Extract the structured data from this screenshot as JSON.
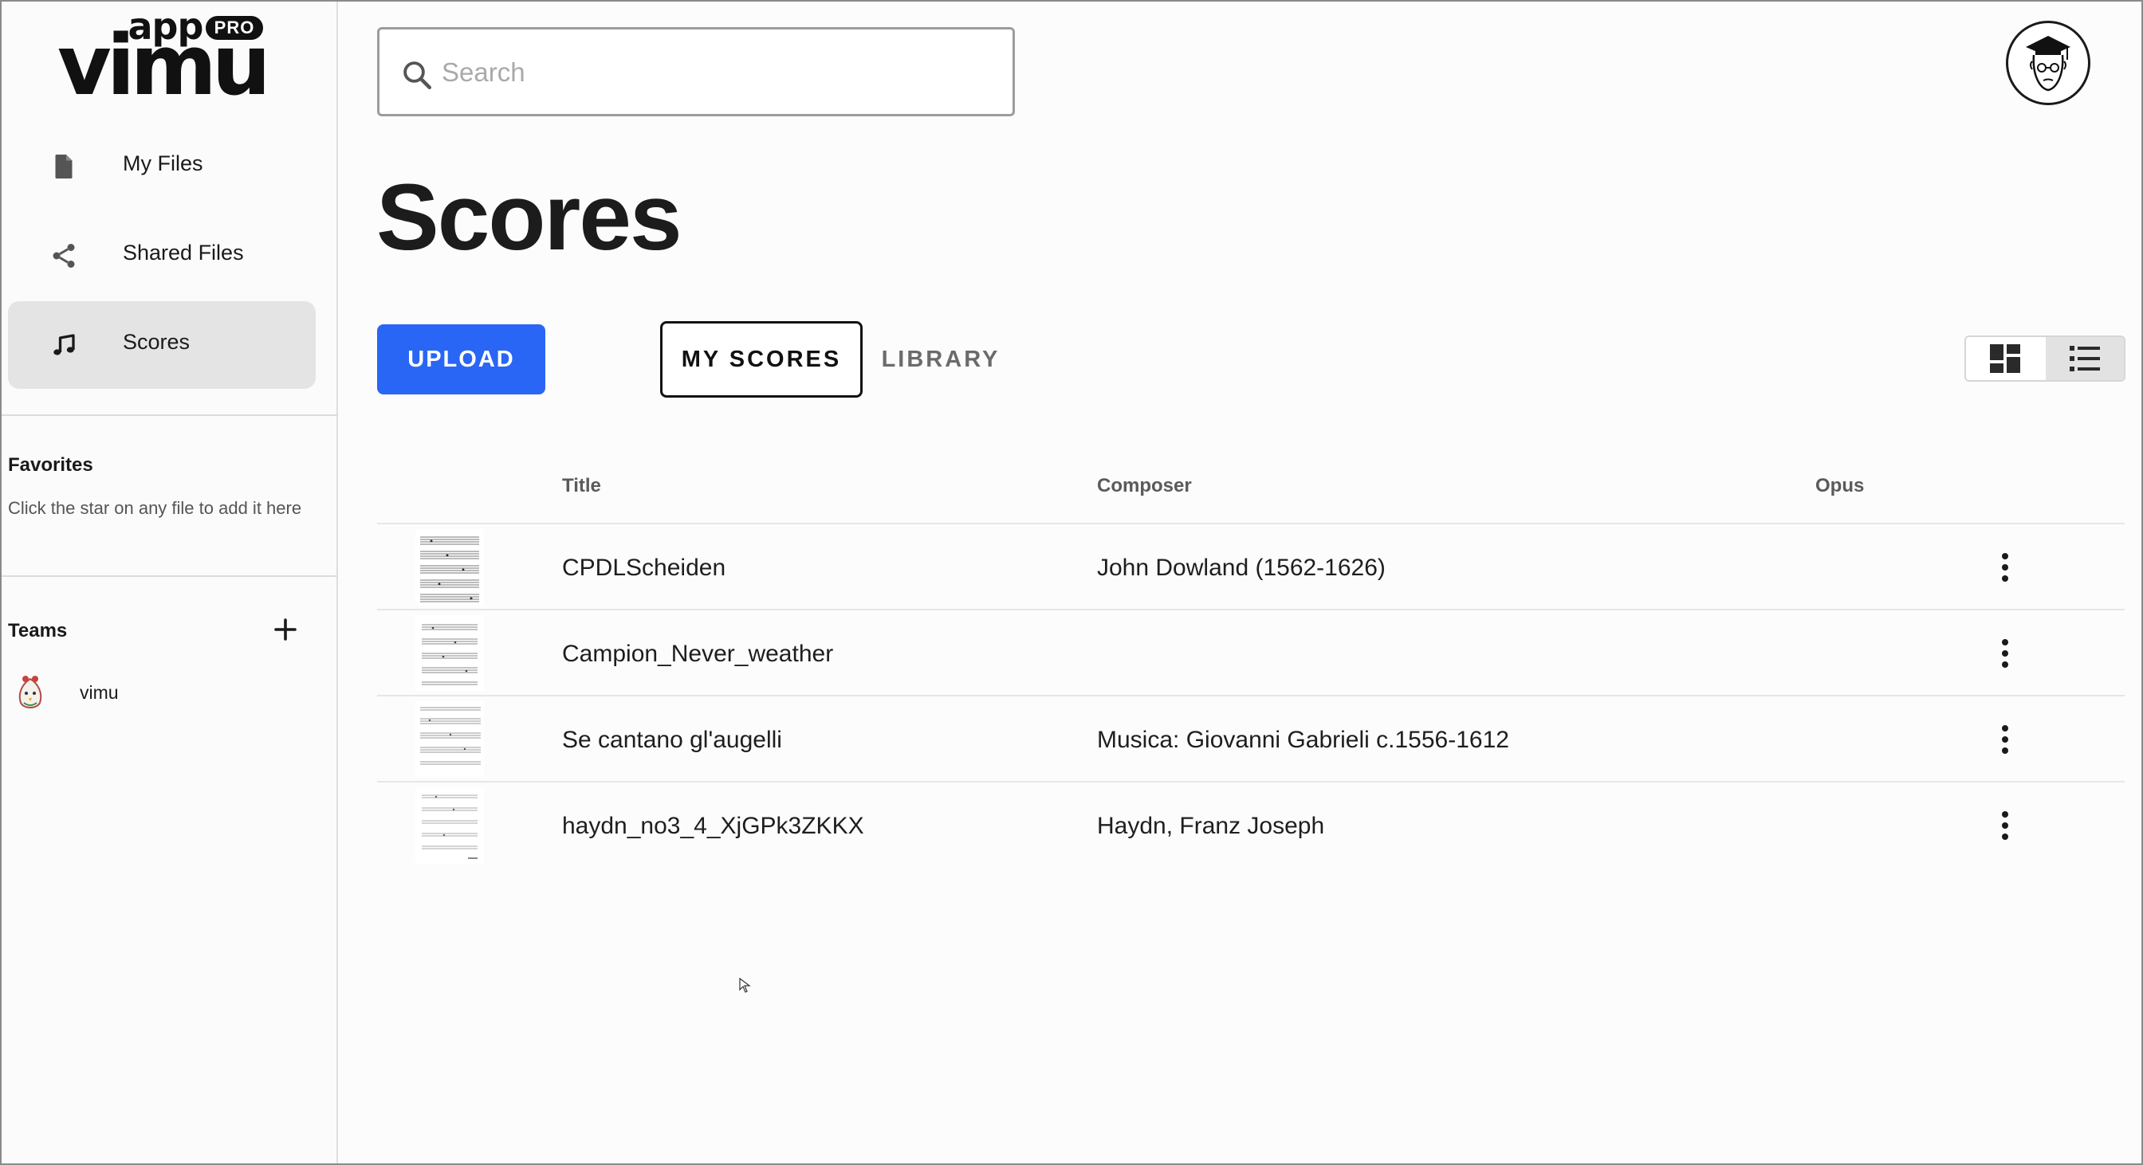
{
  "brand": {
    "wordmark": "vimu",
    "subdomain": ".app",
    "badge": "PRO"
  },
  "sidebar": {
    "nav": [
      {
        "label": "My Files",
        "icon": "file-icon",
        "active": false
      },
      {
        "label": "Shared Files",
        "icon": "share-icon",
        "active": false
      },
      {
        "label": "Scores",
        "icon": "music-note-icon",
        "active": true
      }
    ],
    "favorites": {
      "title": "Favorites",
      "hint": "Click the star on any file to add it here"
    },
    "teams": {
      "title": "Teams",
      "items": [
        {
          "name": "vimu"
        }
      ]
    }
  },
  "search": {
    "placeholder": "Search",
    "value": ""
  },
  "page": {
    "title": "Scores"
  },
  "actions": {
    "upload_label": "UPLOAD"
  },
  "tabs": [
    {
      "label": "MY SCORES",
      "active": true
    },
    {
      "label": "LIBRARY",
      "active": false
    }
  ],
  "view_toggle": {
    "options": [
      "grid-view-icon",
      "list-view-icon"
    ],
    "selected": "list"
  },
  "table": {
    "columns": [
      "Title",
      "Composer",
      "Opus"
    ],
    "rows": [
      {
        "title": "CPDLScheiden",
        "composer": "John Dowland (1562-1626)",
        "opus": ""
      },
      {
        "title": "Campion_Never_weather",
        "composer": "",
        "opus": ""
      },
      {
        "title": "Se cantano gl'augelli",
        "composer": "Musica: Giovanni Gabrieli c.1556-1612",
        "opus": ""
      },
      {
        "title": "haydn_no3_4_XjGPk3ZKKX",
        "composer": "Haydn, Franz Joseph",
        "opus": ""
      }
    ]
  },
  "colors": {
    "primary": "#2a66f5",
    "active_nav": "#e4e4e4",
    "text": "#1f1f1f"
  }
}
